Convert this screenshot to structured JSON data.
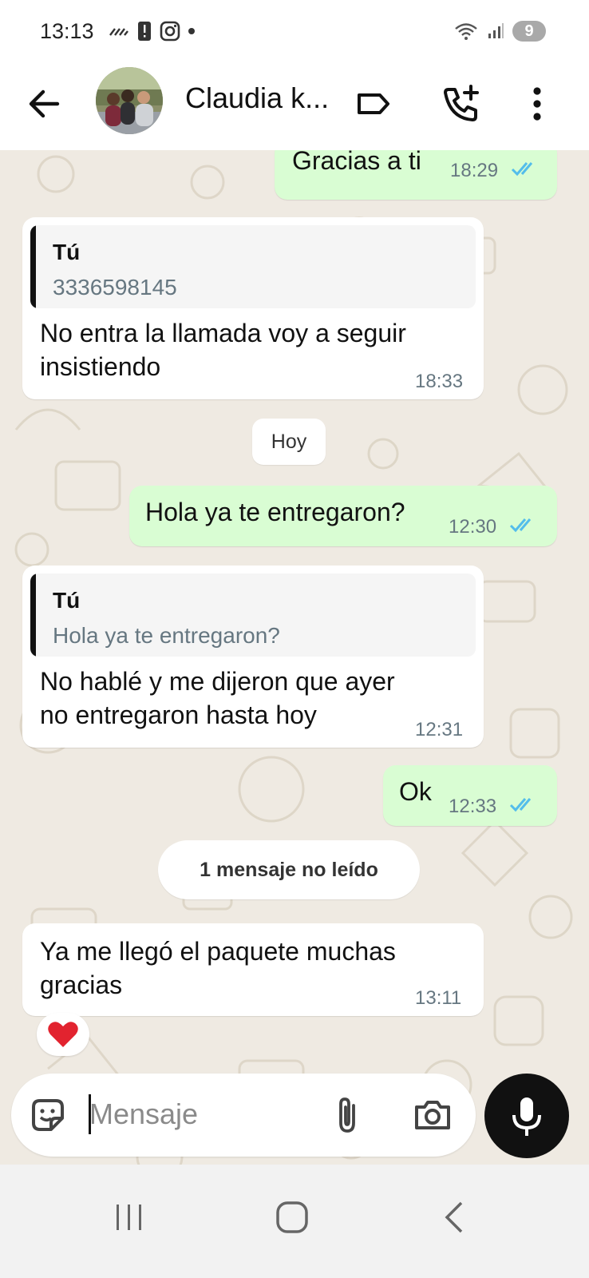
{
  "status_bar": {
    "time": "13:13",
    "icons_left": [
      "signal-noise-icon",
      "alert-icon",
      "instagram-icon",
      "dot-icon"
    ],
    "icons_right": [
      "wifi-icon",
      "cell-signal-icon"
    ],
    "battery_badge": "9"
  },
  "header": {
    "contact_name": "Claudia k...",
    "icons": [
      "back-arrow-icon",
      "label-icon",
      "add-call-icon",
      "more-vert-icon"
    ]
  },
  "messages": [
    {
      "id": "m1",
      "direction": "outgoing",
      "text": "Gracias a ti",
      "time": "18:29",
      "status": "read"
    },
    {
      "id": "m2",
      "direction": "incoming",
      "quote": {
        "author": "Tú",
        "text": "3336598145"
      },
      "text_lines": [
        "No entra la llamada voy a seguir",
        "insistiendo"
      ],
      "time": "18:33"
    },
    {
      "id": "m3",
      "direction": "outgoing",
      "text": "Hola ya te entregaron?",
      "time": "12:30",
      "status": "read"
    },
    {
      "id": "m4",
      "direction": "incoming",
      "quote": {
        "author": "Tú",
        "text": "Hola ya te entregaron?"
      },
      "text_lines": [
        "No hablé y me dijeron que ayer",
        "no entregaron hasta hoy"
      ],
      "time": "12:31"
    },
    {
      "id": "m5",
      "direction": "outgoing",
      "text": "Ok",
      "time": "12:33",
      "status": "read"
    },
    {
      "id": "m6",
      "direction": "incoming",
      "text_lines": [
        "Ya me llegó el paquete muchas",
        "gracias"
      ],
      "time": "13:11",
      "reaction": "❤️"
    }
  ],
  "date_divider": "Hoy",
  "unread_divider": "1 mensaje no leído",
  "composer": {
    "placeholder": "Mensaje",
    "icons": [
      "sticker-icon",
      "attach-icon",
      "camera-icon",
      "mic-icon"
    ]
  },
  "navbar": {
    "icons": [
      "recents-icon",
      "home-icon",
      "back-nav-icon"
    ]
  },
  "colors": {
    "outgoing_bubble": "#d9fdd3",
    "incoming_bubble": "#ffffff",
    "chat_bg": "#efeae2",
    "read_ticks": "#53bdeb"
  }
}
